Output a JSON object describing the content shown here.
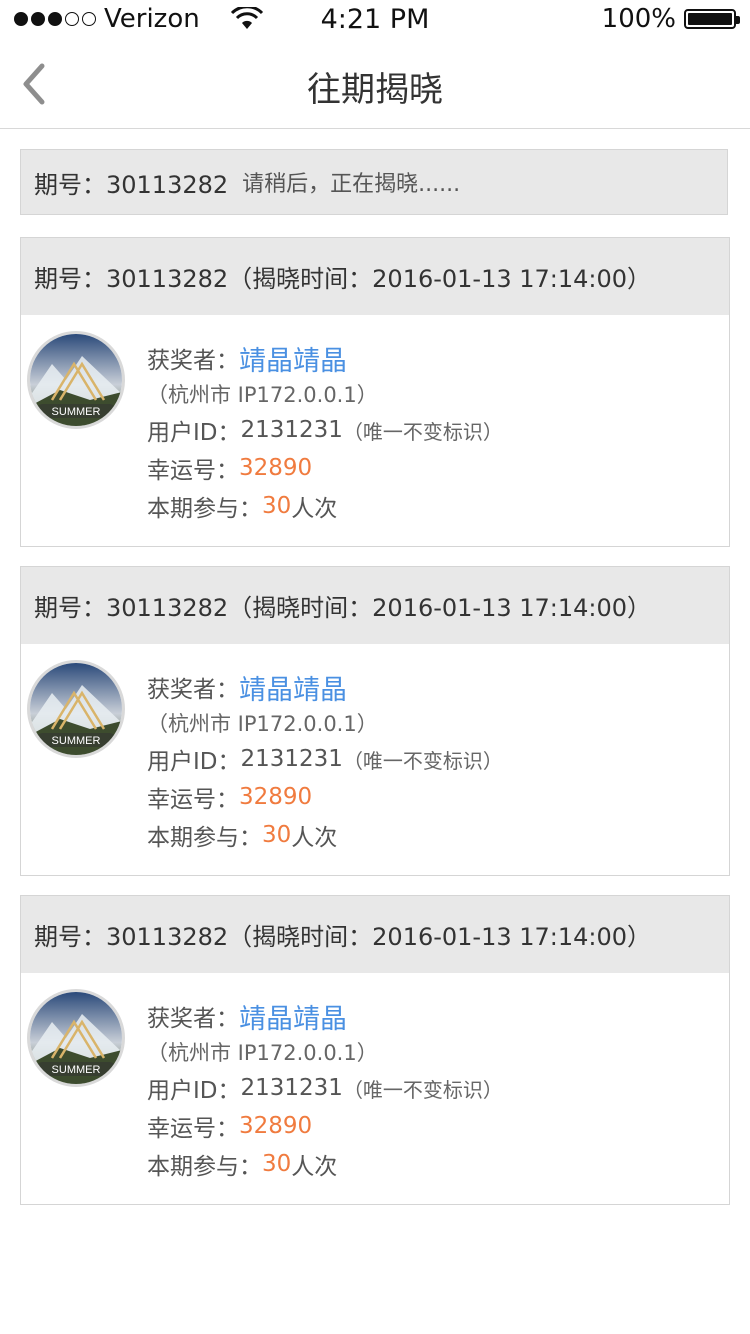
{
  "status_bar": {
    "carrier": "Verizon",
    "time": "4:21 PM",
    "battery": "100%"
  },
  "nav": {
    "title": "往期揭晓"
  },
  "pending": {
    "issue": "期号：30113282",
    "message": "请稍后，正在揭晓......"
  },
  "records": [
    {
      "header": "期号：30113282（揭晓时间：2016-01-13 17:14:00）",
      "winner_label": "获奖者：",
      "winner_name": "靖晶靖晶",
      "location": "（杭州市  IP172.0.0.1）",
      "user_id_label": "用户ID：",
      "user_id": "2131231",
      "user_id_note": "（唯一不变标识）",
      "lucky_label": "幸运号：",
      "lucky_number": "32890",
      "participate_label": "本期参与：",
      "participate_count": "30",
      "participate_unit": "人次",
      "avatar_text": "SUMMER"
    },
    {
      "header": "期号：30113282（揭晓时间：2016-01-13 17:14:00）",
      "winner_label": "获奖者：",
      "winner_name": "靖晶靖晶",
      "location": "（杭州市  IP172.0.0.1）",
      "user_id_label": "用户ID：",
      "user_id": "2131231",
      "user_id_note": "（唯一不变标识）",
      "lucky_label": "幸运号：",
      "lucky_number": "32890",
      "participate_label": "本期参与：",
      "participate_count": "30",
      "participate_unit": "人次",
      "avatar_text": "SUMMER"
    },
    {
      "header": "期号：30113282（揭晓时间：2016-01-13 17:14:00）",
      "winner_label": "获奖者：",
      "winner_name": "靖晶靖晶",
      "location": "（杭州市  IP172.0.0.1）",
      "user_id_label": "用户ID：",
      "user_id": "2131231",
      "user_id_note": "（唯一不变标识）",
      "lucky_label": "幸运号：",
      "lucky_number": "32890",
      "participate_label": "本期参与：",
      "participate_count": "30",
      "participate_unit": "人次",
      "avatar_text": "SUMMER"
    }
  ],
  "colors": {
    "winner_name": "#4a90e2",
    "highlight": "#f07b3f",
    "header_bg": "#e8e8e8"
  }
}
